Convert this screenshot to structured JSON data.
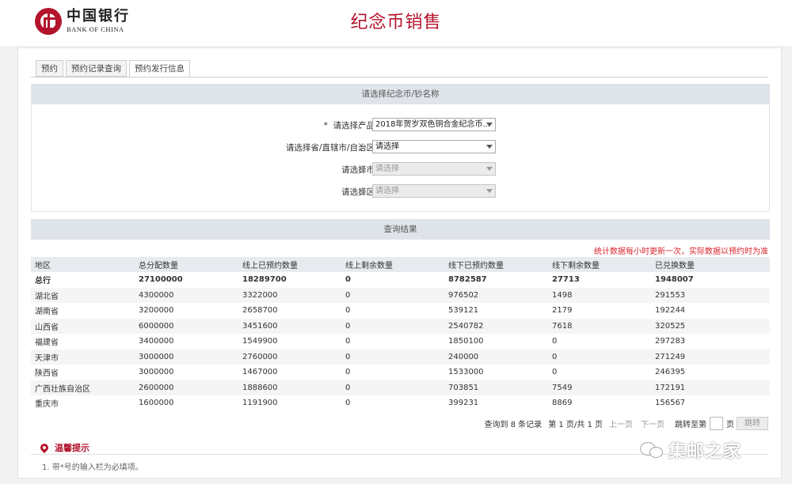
{
  "header": {
    "logo_cn": "中国银行",
    "logo_en": "BANK OF CHINA",
    "title": "纪念币销售"
  },
  "tabs": [
    {
      "label": "预约",
      "active": false
    },
    {
      "label": "预约记录查询",
      "active": false
    },
    {
      "label": "预约发行信息",
      "active": true
    }
  ],
  "select_section": {
    "title": "请选择纪念币/钞名称",
    "fields": [
      {
        "required_mark": "*",
        "label": "请选择产品",
        "colon": "：",
        "value": "2018年贺岁双色铜合金纪念币...",
        "disabled": false
      },
      {
        "required_mark": "",
        "label": "请选择省/直辖市/自治区",
        "colon": "：",
        "value": "请选择",
        "disabled": false
      },
      {
        "required_mark": "",
        "label": "请选择市",
        "colon": "：",
        "value": "请选择",
        "disabled": true
      },
      {
        "required_mark": "",
        "label": "请选择区",
        "colon": "：",
        "value": "请选择",
        "disabled": true
      }
    ]
  },
  "results": {
    "title": "查询结果",
    "notice": "统计数据每小时更新一次，实际数据以预约时为准",
    "columns": [
      "地区",
      "总分配数量",
      "线上已预约数量",
      "线上剩余数量",
      "线下已预约数量",
      "线下剩余数量",
      "已兑换数量"
    ],
    "rows": [
      [
        "总行",
        "27100000",
        "18289700",
        "0",
        "8782587",
        "27713",
        "1948007"
      ],
      [
        "湖北省",
        "4300000",
        "3322000",
        "0",
        "976502",
        "1498",
        "291553"
      ],
      [
        "湖南省",
        "3200000",
        "2658700",
        "0",
        "539121",
        "2179",
        "192244"
      ],
      [
        "山西省",
        "6000000",
        "3451600",
        "0",
        "2540782",
        "7618",
        "320525"
      ],
      [
        "福建省",
        "3400000",
        "1549900",
        "0",
        "1850100",
        "0",
        "297283"
      ],
      [
        "天津市",
        "3000000",
        "2760000",
        "0",
        "240000",
        "0",
        "271249"
      ],
      [
        "陕西省",
        "3000000",
        "1467000",
        "0",
        "1533000",
        "0",
        "246395"
      ],
      [
        "广西壮族自治区",
        "2600000",
        "1888600",
        "0",
        "703851",
        "7549",
        "172191"
      ],
      [
        "重庆市",
        "1600000",
        "1191900",
        "0",
        "399231",
        "8869",
        "156567"
      ]
    ]
  },
  "pager": {
    "summary": "查询到 8 条记录",
    "page_info": "第 1 页/共 1 页",
    "prev": "上一页",
    "next": "下一页",
    "jump_label": "跳转至第",
    "page_unit": "页",
    "go": "跳转"
  },
  "tips": {
    "title": "温馨提示",
    "items": [
      "1. 带*号的输入栏为必填项。"
    ]
  },
  "watermark": {
    "text": "集邮之家"
  },
  "colors": {
    "brand": "#b3142c",
    "notice": "#d8232a",
    "section_bar": "#dfe4ea"
  }
}
